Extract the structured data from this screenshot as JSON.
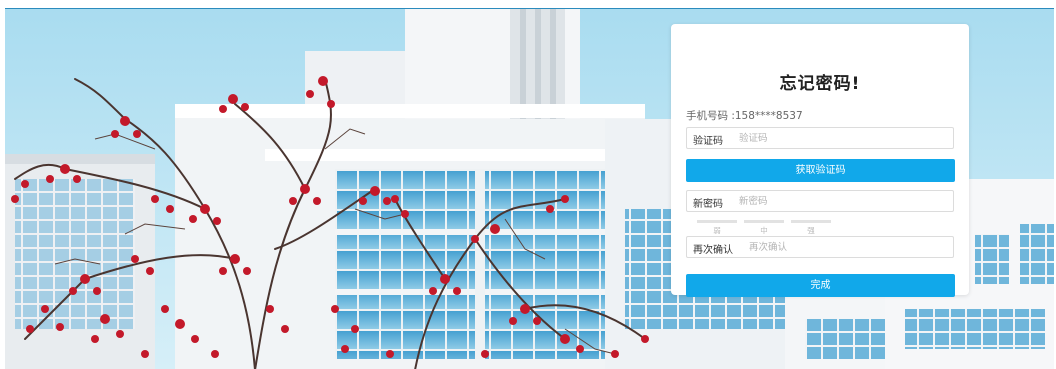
{
  "form": {
    "title": "忘记密码!",
    "phone_text": "手机号码 :158****8537",
    "code_field": {
      "label": "验证码",
      "placeholder": "验证码"
    },
    "get_code_button": "获取验证码",
    "new_password_field": {
      "label": "新密码",
      "placeholder": "新密码"
    },
    "strength_levels": [
      "弱",
      "中",
      "强"
    ],
    "confirm_field": {
      "label": "再次确认",
      "placeholder": "再次确认"
    },
    "submit_button": "完成"
  },
  "colors": {
    "accent": "#11a8ea",
    "sky": "#bfe6f4",
    "building": "#f3f5f7",
    "berry": "#c3192a"
  }
}
